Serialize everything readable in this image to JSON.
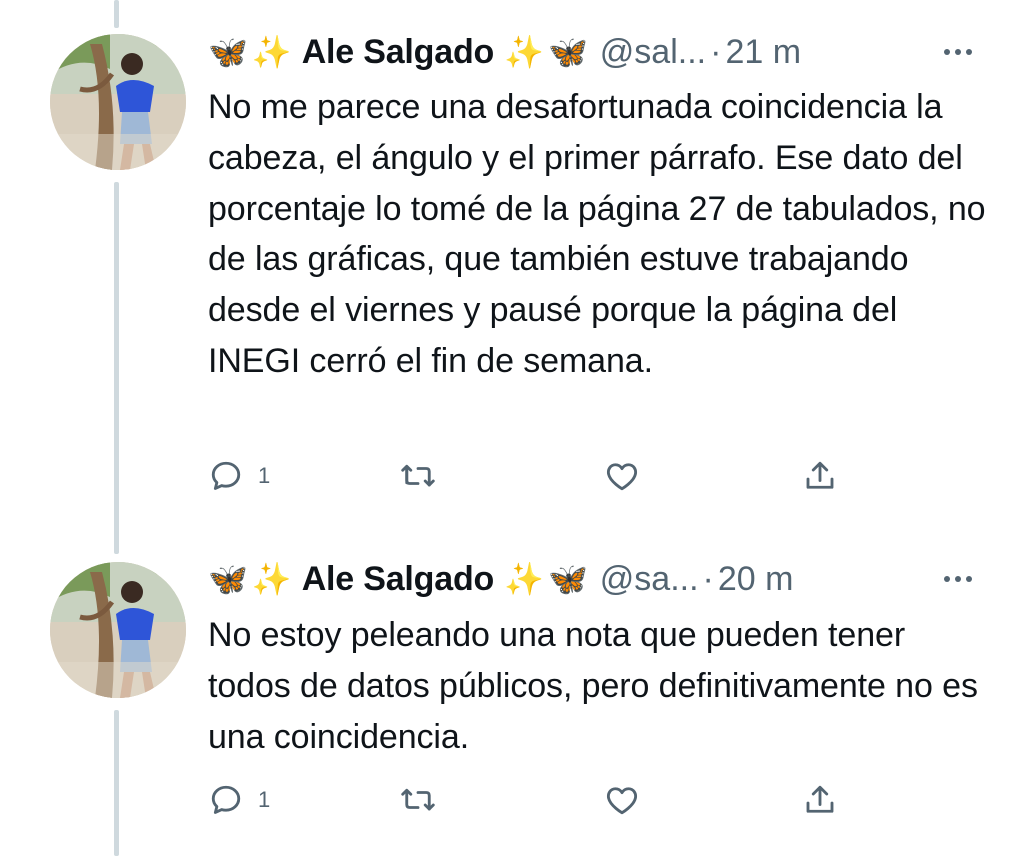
{
  "tweets": [
    {
      "author": "Ale Salgado",
      "handle": "@sal...",
      "time": "21 m",
      "text": "No me parece una desafortunada coincidencia la cabeza, el ángulo y el primer párrafo. Ese dato del porcentaje lo tomé de la página 27 de tabulados, no de las gráficas, que también estuve trabajando desde el viernes y pausé porque la página del INEGI cerró el fin de semana.",
      "reply_count": "1"
    },
    {
      "author": "Ale Salgado",
      "handle": "@sa...",
      "time": "20 m",
      "text": "No estoy peleando una nota que pueden tener todos de datos públicos, pero definitivamente no es una coincidencia.",
      "reply_count": "1"
    }
  ],
  "glyphs": {
    "butterfly": "🦋",
    "sparkles": "✨",
    "separator": "·"
  },
  "colors": {
    "text": "#0f1419",
    "secondary": "#536471",
    "thread_line": "#cfd9de",
    "butterfly": "#2b6fd6",
    "sparkles": "#f4c430"
  },
  "icons": [
    "reply-icon",
    "retweet-icon",
    "like-icon",
    "share-icon",
    "more-icon"
  ]
}
